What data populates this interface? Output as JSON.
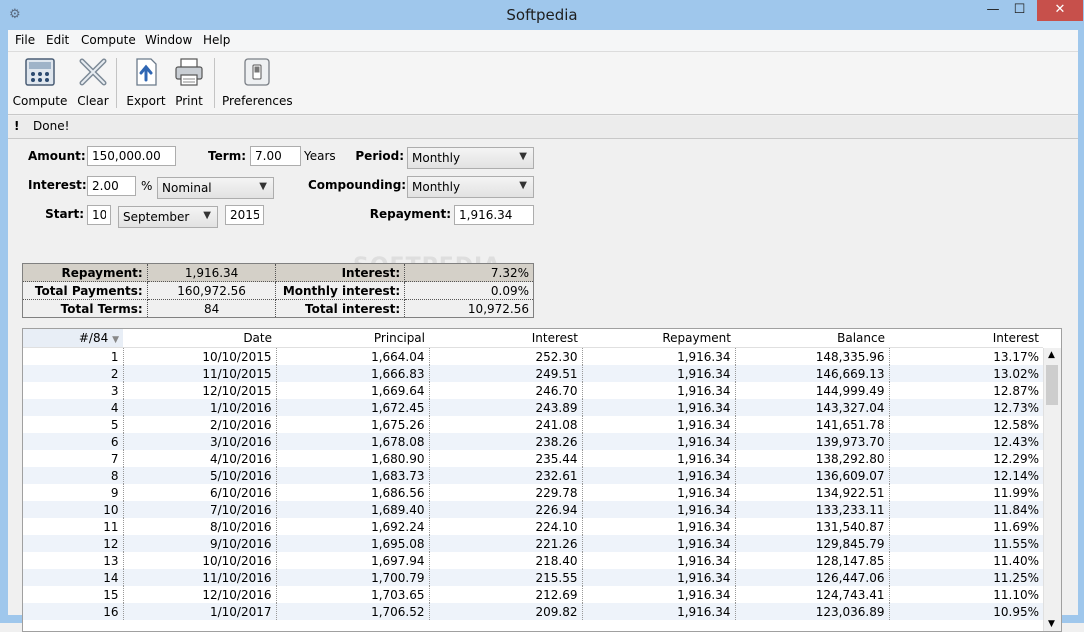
{
  "window": {
    "title": "Softpedia",
    "min": "—",
    "max": "☐",
    "close": "✕"
  },
  "menu": [
    "File",
    "Edit",
    "Compute",
    "Window",
    "Help"
  ],
  "toolbar": {
    "compute": "Compute",
    "clear": "Clear",
    "export": "Export",
    "print": "Print",
    "preferences": "Preferences"
  },
  "status": {
    "icon": "!",
    "text": "Done!"
  },
  "form": {
    "amount_label": "Amount:",
    "amount": "150,000.00",
    "term_label": "Term:",
    "term": "7.00",
    "term_unit": "Years",
    "period_label": "Period:",
    "period": "Monthly",
    "interest_label": "Interest:",
    "interest": "2.00",
    "interest_unit": "%",
    "interest_type": "Nominal",
    "compounding_label": "Compounding:",
    "compounding": "Monthly",
    "start_label": "Start:",
    "start_day": "10",
    "start_month": "September",
    "start_year": "2015",
    "repayment_label": "Repayment:",
    "repayment": "1,916.34"
  },
  "summary": [
    [
      "Repayment:",
      "1,916.34",
      "Interest:",
      "7.32%"
    ],
    [
      "Total Payments:",
      "160,972.56",
      "Monthly interest:",
      "0.09%"
    ],
    [
      "Total Terms:",
      "84",
      "Total interest:",
      "10,972.56"
    ]
  ],
  "grid": {
    "headers": [
      "#/84",
      "Date",
      "Principal",
      "Interest",
      "Repayment",
      "Balance",
      "Interest"
    ],
    "rows": [
      [
        "1",
        "10/10/2015",
        "1,664.04",
        "252.30",
        "1,916.34",
        "148,335.96",
        "13.17%"
      ],
      [
        "2",
        "11/10/2015",
        "1,666.83",
        "249.51",
        "1,916.34",
        "146,669.13",
        "13.02%"
      ],
      [
        "3",
        "12/10/2015",
        "1,669.64",
        "246.70",
        "1,916.34",
        "144,999.49",
        "12.87%"
      ],
      [
        "4",
        "1/10/2016",
        "1,672.45",
        "243.89",
        "1,916.34",
        "143,327.04",
        "12.73%"
      ],
      [
        "5",
        "2/10/2016",
        "1,675.26",
        "241.08",
        "1,916.34",
        "141,651.78",
        "12.58%"
      ],
      [
        "6",
        "3/10/2016",
        "1,678.08",
        "238.26",
        "1,916.34",
        "139,973.70",
        "12.43%"
      ],
      [
        "7",
        "4/10/2016",
        "1,680.90",
        "235.44",
        "1,916.34",
        "138,292.80",
        "12.29%"
      ],
      [
        "8",
        "5/10/2016",
        "1,683.73",
        "232.61",
        "1,916.34",
        "136,609.07",
        "12.14%"
      ],
      [
        "9",
        "6/10/2016",
        "1,686.56",
        "229.78",
        "1,916.34",
        "134,922.51",
        "11.99%"
      ],
      [
        "10",
        "7/10/2016",
        "1,689.40",
        "226.94",
        "1,916.34",
        "133,233.11",
        "11.84%"
      ],
      [
        "11",
        "8/10/2016",
        "1,692.24",
        "224.10",
        "1,916.34",
        "131,540.87",
        "11.69%"
      ],
      [
        "12",
        "9/10/2016",
        "1,695.08",
        "221.26",
        "1,916.34",
        "129,845.79",
        "11.55%"
      ],
      [
        "13",
        "10/10/2016",
        "1,697.94",
        "218.40",
        "1,916.34",
        "128,147.85",
        "11.40%"
      ],
      [
        "14",
        "11/10/2016",
        "1,700.79",
        "215.55",
        "1,916.34",
        "126,447.06",
        "11.25%"
      ],
      [
        "15",
        "12/10/2016",
        "1,703.65",
        "212.69",
        "1,916.34",
        "124,743.41",
        "11.10%"
      ],
      [
        "16",
        "1/10/2017",
        "1,706.52",
        "209.82",
        "1,916.34",
        "123,036.89",
        "10.95%"
      ]
    ]
  }
}
